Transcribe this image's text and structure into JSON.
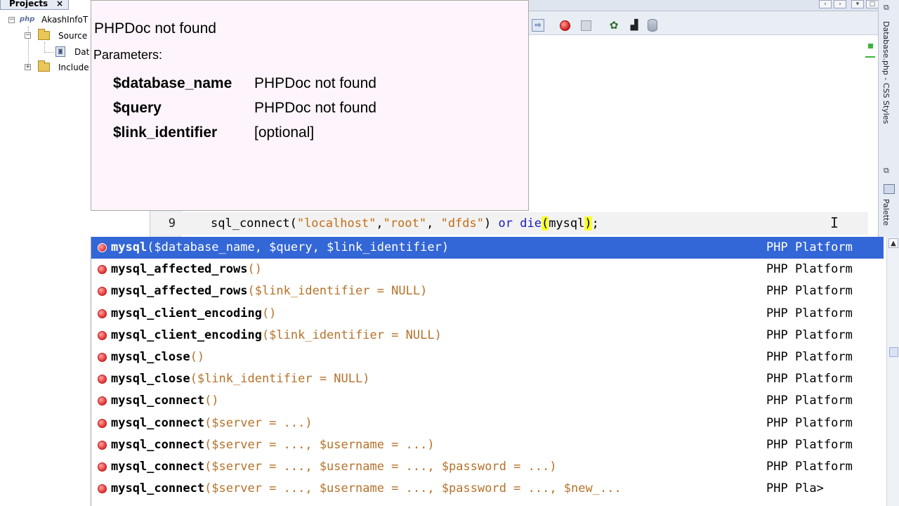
{
  "projects": {
    "tab_label": "Projects",
    "close_glyph": "×",
    "items": [
      {
        "label": "AkashInfoT",
        "icon": "php"
      },
      {
        "label": "Source"
      },
      {
        "label": "Dat"
      },
      {
        "label": "Include"
      }
    ]
  },
  "editor": {
    "line_number": "9",
    "code": {
      "t1": "sql_connect(",
      "s1": "\"localhost\"",
      "t2": ",",
      "s2": "\"root\"",
      "t3": ", ",
      "s3": "\"dfds\"",
      "t4": ") ",
      "k1": "or",
      "t5": " ",
      "k2": "die",
      "h1": "(",
      "t6": "mysql",
      "h2": ")",
      "t7": ";"
    }
  },
  "doc_popup": {
    "title": "PHPDoc not found",
    "params_label": "Parameters:",
    "params": [
      {
        "name": "$database_name",
        "desc": "PHPDoc not found"
      },
      {
        "name": "$query",
        "desc": "PHPDoc not found"
      },
      {
        "name": "$link_identifier",
        "desc": "[optional]"
      }
    ]
  },
  "completion": {
    "items": [
      {
        "name": "mysql",
        "params": "($database_name, $query, $link_identifier)",
        "source": "PHP Platform",
        "selected": true
      },
      {
        "name": "mysql_affected_rows",
        "params": "()",
        "source": "PHP Platform"
      },
      {
        "name": "mysql_affected_rows",
        "params": "($link_identifier = NULL)",
        "source": "PHP Platform"
      },
      {
        "name": "mysql_client_encoding",
        "params": "()",
        "source": "PHP Platform"
      },
      {
        "name": "mysql_client_encoding",
        "params": "($link_identifier = NULL)",
        "source": "PHP Platform"
      },
      {
        "name": "mysql_close",
        "params": "()",
        "source": "PHP Platform"
      },
      {
        "name": "mysql_close",
        "params": "($link_identifier = NULL)",
        "source": "PHP Platform"
      },
      {
        "name": "mysql_connect",
        "params": "()",
        "source": "PHP Platform"
      },
      {
        "name": "mysql_connect",
        "params": "($server = ...)",
        "source": "PHP Platform"
      },
      {
        "name": "mysql_connect",
        "params": "($server = ..., $username = ...)",
        "source": "PHP Platform"
      },
      {
        "name": "mysql_connect",
        "params": "($server = ..., $username = ..., $password = ...)",
        "source": "PHP Platform"
      },
      {
        "name": "mysql_connect",
        "params": "($server = ..., $username = ..., $password = ..., $new_...",
        "source": "PHP Pla>"
      }
    ]
  },
  "right_strip": {
    "label_1": "Database.php - CSS Styles",
    "label_2": "Palette"
  },
  "toolbar": {
    "icons": [
      "run-file-icon",
      "record-icon",
      "stop-icon",
      "tools-icon",
      "pixel-icon",
      "database-icon"
    ]
  }
}
